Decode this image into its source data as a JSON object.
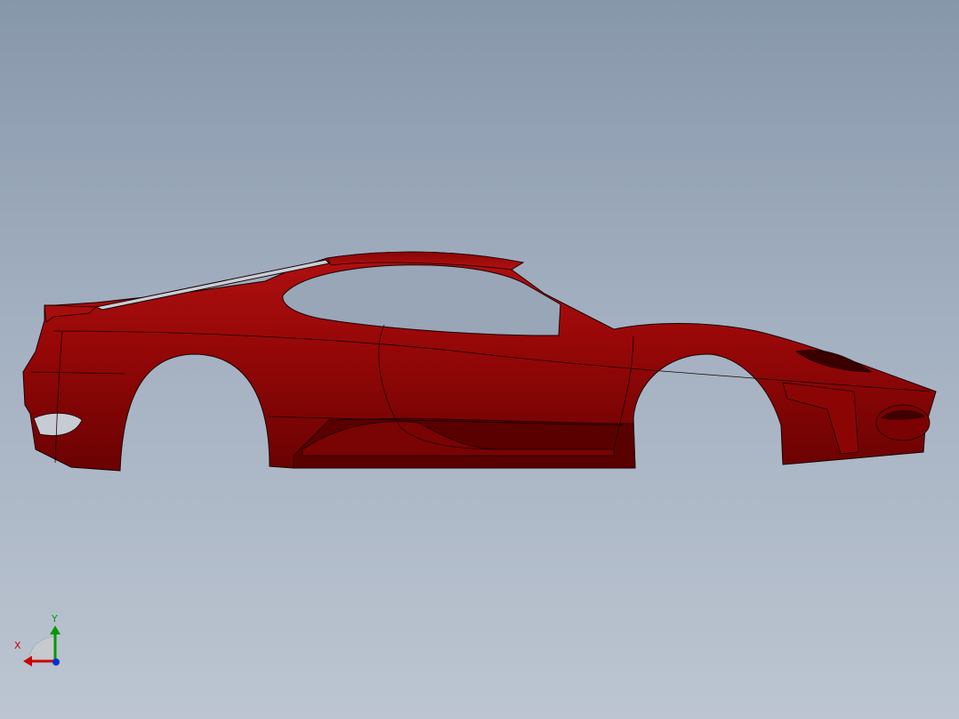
{
  "model": {
    "name": "sports-car-body-shell",
    "view": "side-profile"
  },
  "colors": {
    "background_top": "#8797aa",
    "background_bottom": "#bcc5d1",
    "body_main": "#a10a0a",
    "body_dark": "#6e0303",
    "body_shadow": "#4a0000",
    "edge_lines": "#1a0000",
    "axis_x": "#cc0000",
    "axis_y": "#009900",
    "axis_z": "#0033cc"
  },
  "triad": {
    "x_label": "X",
    "y_label": "Y"
  }
}
